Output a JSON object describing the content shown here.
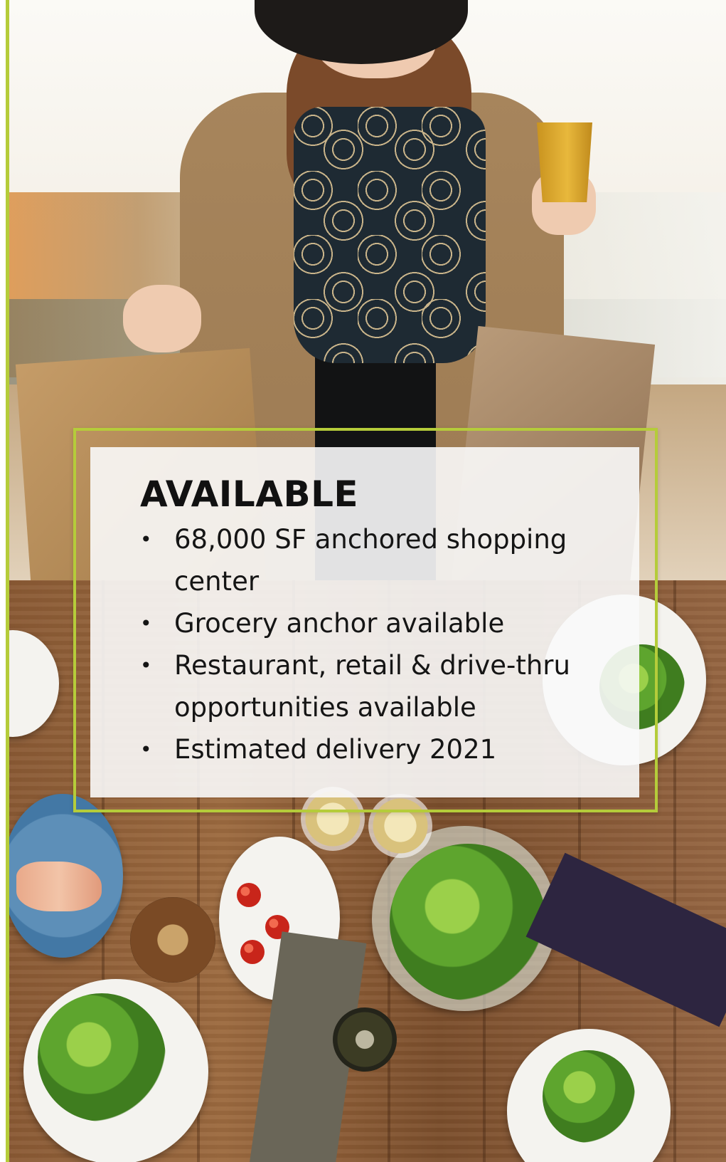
{
  "available": {
    "title": "AVAILABLE",
    "bullet_glyph": "•",
    "items": [
      "68,000 SF anchored shopping center",
      "Grocery anchor available",
      "Restaurant, retail & drive-thru opportunities available",
      "Estimated delivery 2021"
    ]
  },
  "colors": {
    "accent": "#b5cc3a",
    "panel_background": "#fafafa",
    "text": "#111111"
  }
}
